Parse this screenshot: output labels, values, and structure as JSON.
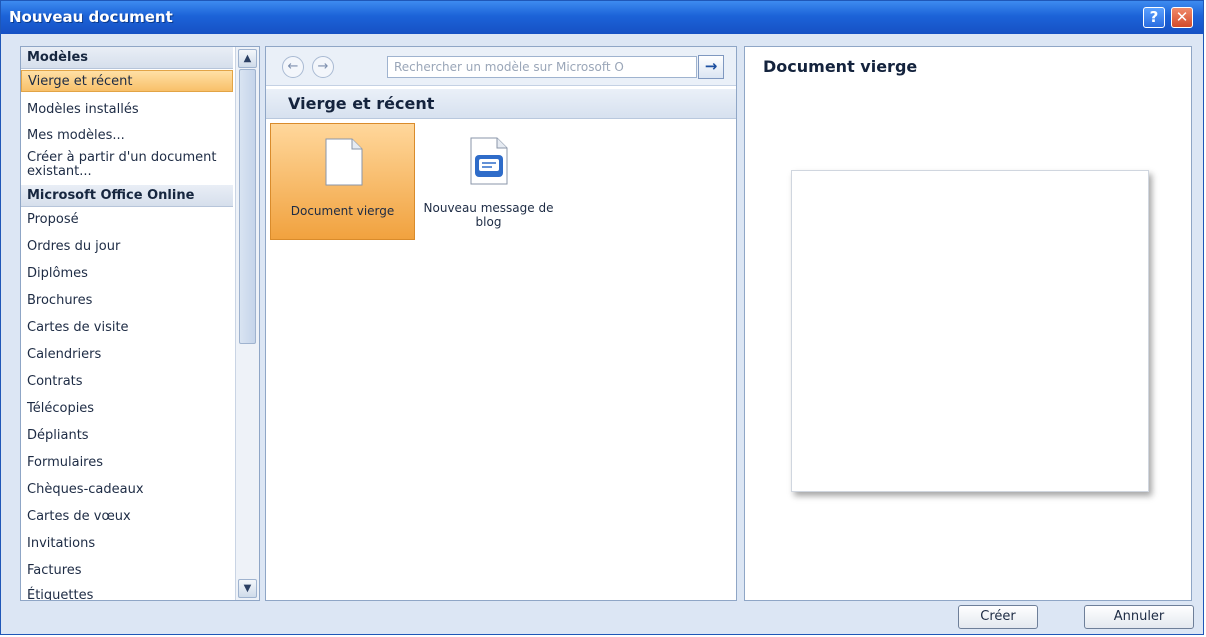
{
  "window": {
    "title": "Nouveau document"
  },
  "titlebar_buttons": {
    "help": "?",
    "close": "✕"
  },
  "sidebar": {
    "items": [
      {
        "label": "Modèles",
        "kind": "header"
      },
      {
        "label": "Vierge et récent",
        "kind": "selected"
      },
      {
        "label": "Modèles installés",
        "kind": "item"
      },
      {
        "label": "Mes modèles...",
        "kind": "item"
      },
      {
        "label": "Créer à partir d'un document existant...",
        "kind": "two-line"
      },
      {
        "label": "Microsoft Office Online",
        "kind": "header"
      },
      {
        "label": "Proposé",
        "kind": "item"
      },
      {
        "label": "Ordres du jour",
        "kind": "item"
      },
      {
        "label": "Diplômes",
        "kind": "item"
      },
      {
        "label": "Brochures",
        "kind": "item"
      },
      {
        "label": "Cartes de visite",
        "kind": "item"
      },
      {
        "label": "Calendriers",
        "kind": "item"
      },
      {
        "label": "Contrats",
        "kind": "item"
      },
      {
        "label": "Télécopies",
        "kind": "item"
      },
      {
        "label": "Dépliants",
        "kind": "item"
      },
      {
        "label": "Formulaires",
        "kind": "item"
      },
      {
        "label": "Chèques-cadeaux",
        "kind": "item"
      },
      {
        "label": "Cartes de vœux",
        "kind": "item"
      },
      {
        "label": "Invitations",
        "kind": "item"
      },
      {
        "label": "Factures",
        "kind": "item"
      },
      {
        "label": "Étiquettes",
        "kind": "item"
      }
    ]
  },
  "nav": {
    "back_icon": "arrow-left-icon",
    "forward_icon": "arrow-right-icon",
    "search_placeholder": "Rechercher un modèle sur Microsoft O",
    "search_go_icon": "arrow-right-icon"
  },
  "main": {
    "section_title": "Vierge et récent",
    "tiles": [
      {
        "label": "Document vierge",
        "icon": "blank-document-icon"
      },
      {
        "label": "Nouveau message de blog",
        "icon": "blog-post-icon"
      }
    ]
  },
  "preview": {
    "title": "Document vierge"
  },
  "footer": {
    "create_label": "Créer",
    "cancel_label": "Annuler"
  },
  "colors": {
    "titlebar": "#1c63d8",
    "selection": "#f8c069",
    "pane_border": "#8fa6c6"
  }
}
